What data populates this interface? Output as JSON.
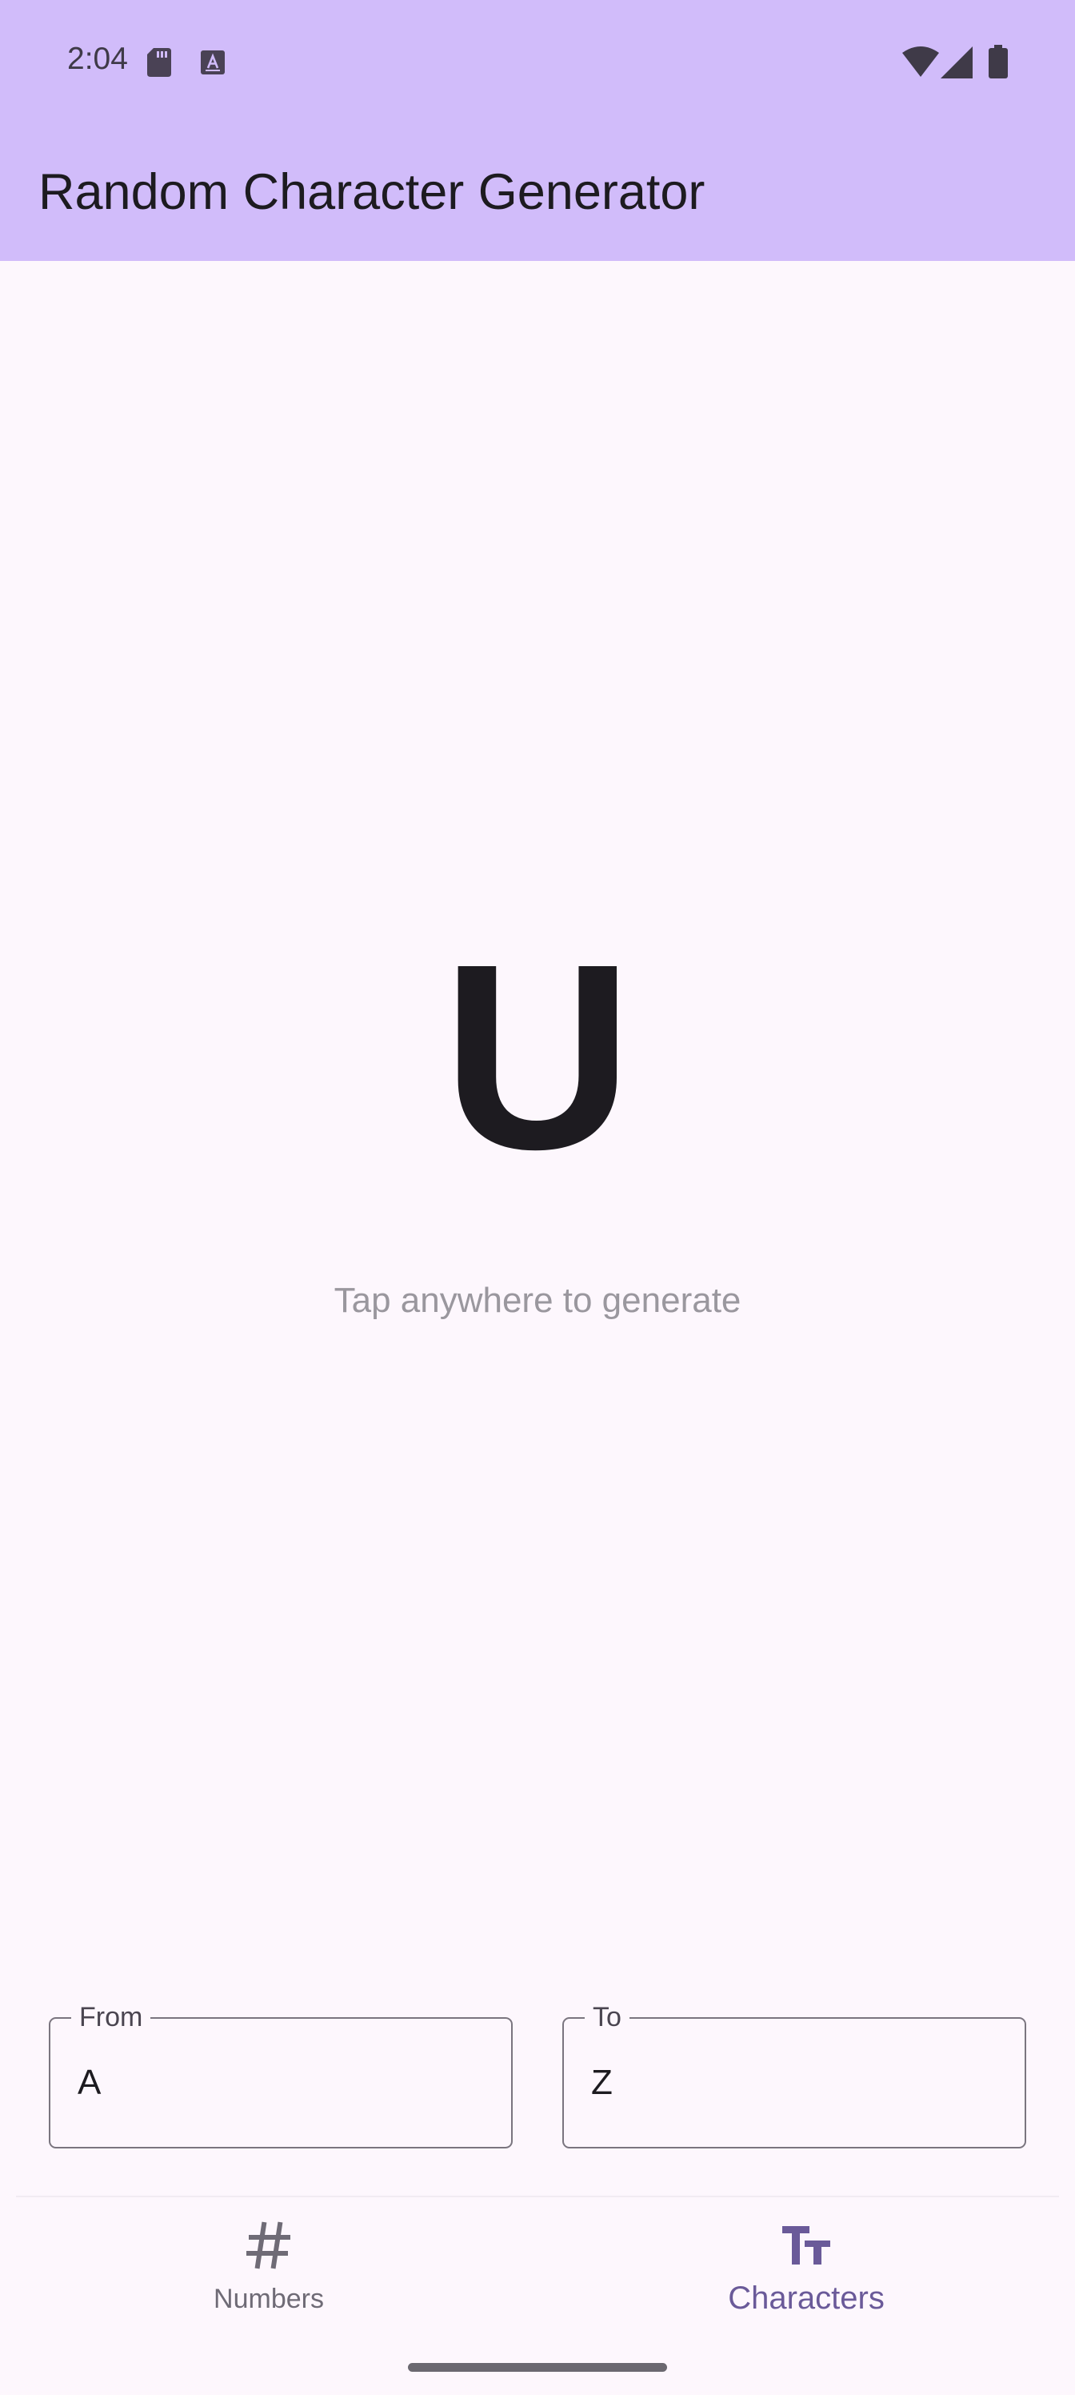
{
  "status_bar": {
    "time": "2:04",
    "icons": [
      "sd-card-icon",
      "a-box-icon",
      "wifi-icon",
      "signal-icon",
      "battery-icon"
    ]
  },
  "app_bar": {
    "title": "Random Character Generator"
  },
  "main": {
    "generated_character": "U",
    "hint": "Tap anywhere to generate"
  },
  "range": {
    "from_label": "From",
    "from_value": "A",
    "to_label": "To",
    "to_value": "Z"
  },
  "bottom_nav": {
    "items": [
      {
        "label": "Numbers",
        "icon": "hash-icon",
        "selected": false
      },
      {
        "label": "Characters",
        "icon": "text-size-icon",
        "selected": true
      }
    ]
  },
  "colors": {
    "app_bar": "#d1bcfa",
    "background": "#fdf7fd",
    "accent": "#6a5a99"
  }
}
